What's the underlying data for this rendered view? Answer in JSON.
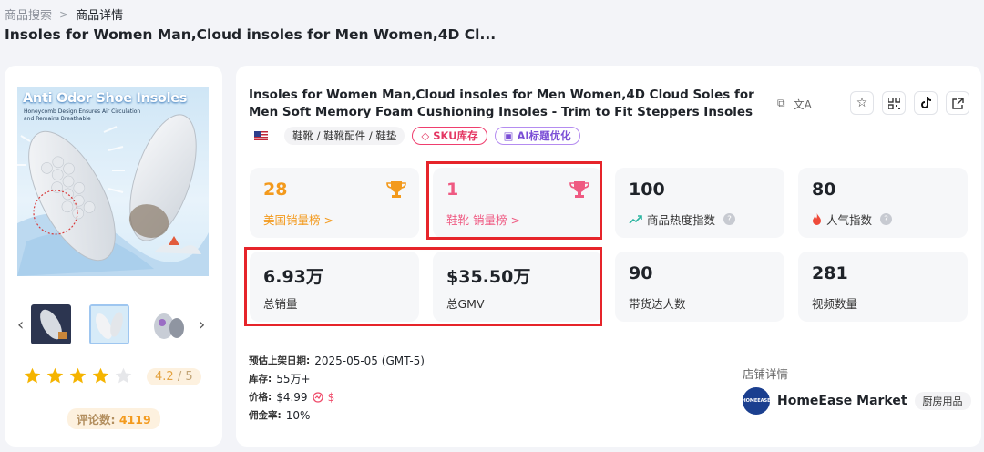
{
  "breadcrumb": {
    "parent": "商品搜索",
    "current": "商品详情"
  },
  "page_title": "Insoles for Women Man,Cloud insoles for Men Women,4D Cl...",
  "product": {
    "image_title": "Anti Odor Shoe Insoles",
    "image_subtitle": "Honeycomb Design Ensures Air Circulation and Remains Breathable",
    "rating": "4.2",
    "rating_max": "/ 5",
    "rating_stars_filled": 4,
    "review_label": "评论数:",
    "review_count": "4119"
  },
  "detail": {
    "title": "Insoles for Women Man,Cloud insoles for Men Women,4D Cloud Soles for Men Soft Memory Foam Cushioning Insoles - Trim to Fit Steppers Insoles",
    "category": "鞋靴 / 鞋靴配件 / 鞋垫",
    "sku_chip": "SKU库存",
    "ai_chip": "AI标题优化"
  },
  "stats": {
    "us_rank": {
      "value": "28",
      "label": "美国销量榜 >"
    },
    "cat_rank": {
      "value": "1",
      "label": "鞋靴 销量榜 >"
    },
    "heat": {
      "value": "100",
      "label": "商品热度指数"
    },
    "popularity": {
      "value": "80",
      "label": "人气指数"
    },
    "total_sales": {
      "value": "6.93万",
      "label": "总销量"
    },
    "gmv": {
      "value": "$35.50万",
      "label": "总GMV"
    },
    "creators": {
      "value": "90",
      "label": "带货达人数"
    },
    "videos": {
      "value": "281",
      "label": "视频数量"
    }
  },
  "info": {
    "launch_key": "预估上架日期:",
    "launch_value": "2025-05-05 (GMT-5)",
    "stock_key": "库存:",
    "stock_value": "55万+",
    "price_key": "价格:",
    "price_value": "$4.99",
    "commission_key": "佣金率:",
    "commission_value": "10%"
  },
  "store": {
    "section_label": "店铺详情",
    "logo_text": "HOMEEASE",
    "name": "HomeEase Market",
    "tag": "厨房用品"
  },
  "colors": {
    "accent_orange": "#f39a1d",
    "accent_pink": "#ef5a82",
    "highlight_red": "#e6242a"
  }
}
